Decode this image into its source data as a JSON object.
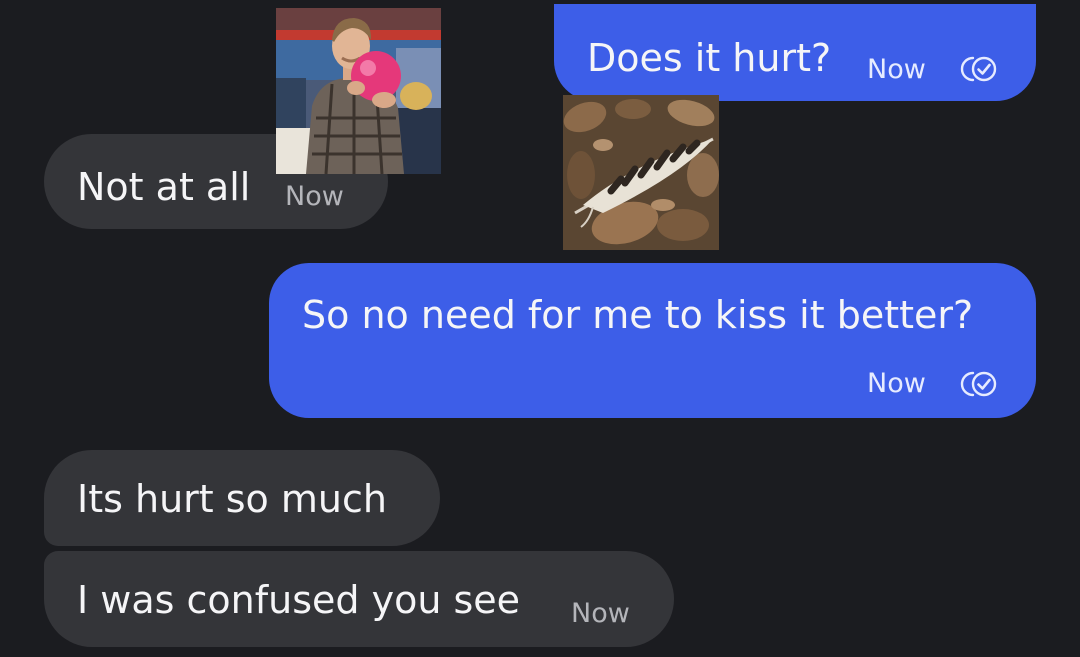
{
  "conversation": {
    "messages": [
      {
        "direction": "outgoing",
        "text": "Does it hurt?",
        "time": "Now",
        "status_icon": "read-receipt-check-icon"
      },
      {
        "direction": "incoming",
        "text": "Not at all",
        "time": "Now"
      },
      {
        "direction": "outgoing",
        "text": "So no need for me to kiss it better?",
        "time": "Now",
        "status_icon": "read-receipt-check-icon"
      },
      {
        "direction": "incoming",
        "text": "Its hurt so much",
        "time": ""
      },
      {
        "direction": "incoming",
        "text": "I was confused you see",
        "time": "Now"
      }
    ],
    "overlay_images": [
      {
        "name": "man-bowling-ball-photo",
        "subject": "man in plaid shirt holding pink bowling ball"
      },
      {
        "name": "feather-on-leaves-photo",
        "subject": "striped feather on dry leaves"
      }
    ]
  },
  "colors": {
    "background": "#1b1c20",
    "outgoing_bubble": "#3d5ee8",
    "incoming_bubble": "#343539",
    "text": "#f5f5f7",
    "incoming_time": "#b4b5ba"
  }
}
